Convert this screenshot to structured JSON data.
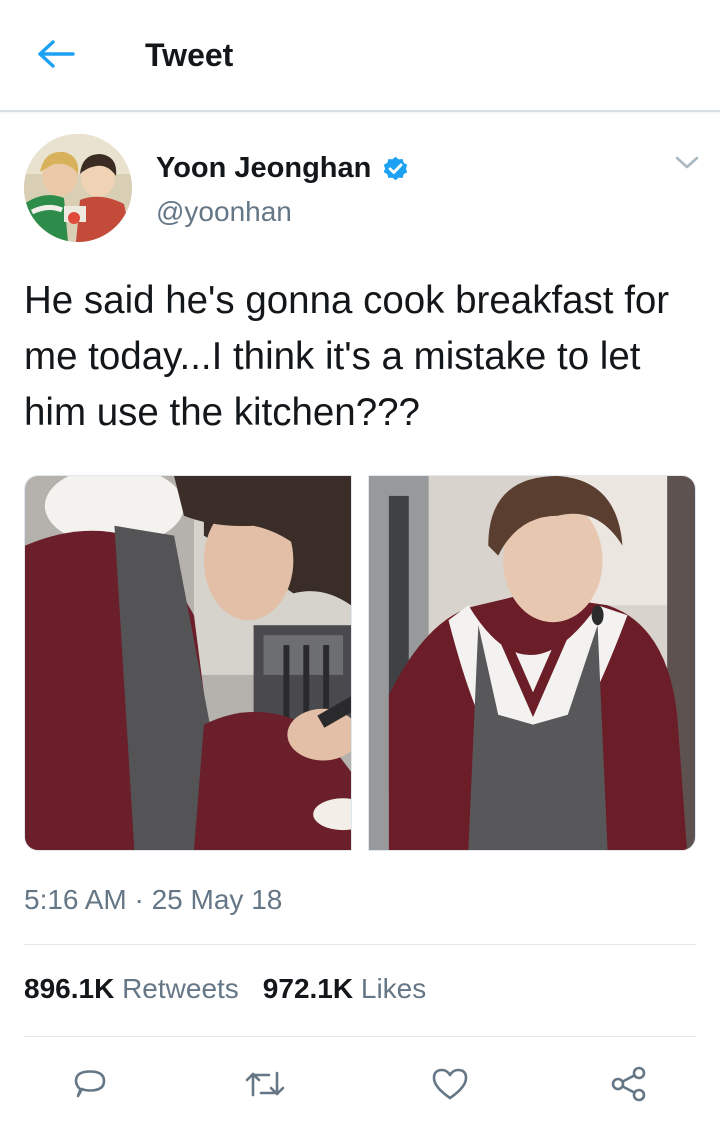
{
  "header": {
    "title": "Tweet",
    "back_icon": "arrow-left-icon"
  },
  "colors": {
    "accent": "#1da1f2",
    "text": "#14171a",
    "muted": "#657786",
    "border": "#e1e8ed"
  },
  "author": {
    "name": "Yoon Jeonghan",
    "handle": "@yoonhan",
    "verified": true
  },
  "tweet": {
    "text": "He said he's gonna cook breakfast for me today...I think it's a mistake to let him use the kitchen???",
    "media_count": 2,
    "timestamp": "5:16 AM · 25 May 18"
  },
  "stats": {
    "retweets_count": "896.1K",
    "retweets_label": "Retweets",
    "likes_count": "972.1K",
    "likes_label": "Likes"
  },
  "actions": [
    "reply-icon",
    "retweet-icon",
    "heart-icon",
    "share-icon"
  ]
}
